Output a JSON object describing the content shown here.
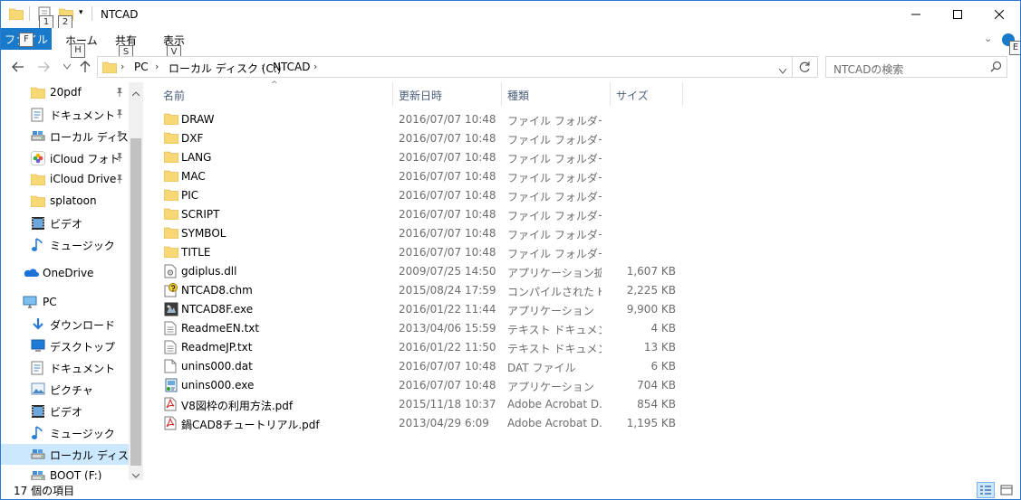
{
  "window": {
    "title": "NTCAD",
    "keytips": [
      "1",
      "2"
    ]
  },
  "ribbon": {
    "file_label": "ファイル",
    "file_keytip": "F",
    "tabs": [
      {
        "label": "ホーム",
        "keytip": "H"
      },
      {
        "label": "共有",
        "keytip": "S"
      },
      {
        "label": "表示",
        "keytip": "V"
      }
    ],
    "help_keytip": "E"
  },
  "address": {
    "crumbs": [
      "PC",
      "ローカル ディスク (C:)",
      "NTCAD"
    ]
  },
  "search": {
    "placeholder": "NTCADの検索"
  },
  "nav": {
    "items": [
      {
        "label": "20pdf",
        "icon": "folder-icon",
        "pinned": true
      },
      {
        "label": "ドキュメント",
        "icon": "documents-icon",
        "pinned": true
      },
      {
        "label": "ローカル ディスク",
        "icon": "drive-icon",
        "pinned": true
      },
      {
        "label": "iCloud フォト",
        "icon": "icloud-photos-icon",
        "pinned": true
      },
      {
        "label": "iCloud Drive",
        "icon": "icloud-drive-icon",
        "pinned": true
      },
      {
        "label": "splatoon",
        "icon": "folder-icon",
        "pinned": false
      },
      {
        "label": "ビデオ",
        "icon": "video-icon",
        "pinned": false
      },
      {
        "label": "ミュージック",
        "icon": "music-icon",
        "pinned": false
      },
      {
        "label": "OneDrive",
        "icon": "onedrive-icon",
        "pinned": false
      },
      {
        "label": "PC",
        "icon": "pc-icon",
        "pinned": false
      },
      {
        "label": "ダウンロード",
        "icon": "download-icon",
        "pinned": false
      },
      {
        "label": "デスクトップ",
        "icon": "desktop-icon",
        "pinned": false
      },
      {
        "label": "ドキュメント",
        "icon": "documents-icon",
        "pinned": false
      },
      {
        "label": "ピクチャ",
        "icon": "pictures-icon",
        "pinned": false
      },
      {
        "label": "ビデオ",
        "icon": "video-icon",
        "pinned": false
      },
      {
        "label": "ミュージック",
        "icon": "music-icon",
        "pinned": false
      },
      {
        "label": "ローカル ディスク (C",
        "icon": "drive-icon",
        "pinned": false,
        "selected": true
      },
      {
        "label": "BOOT (F:)",
        "icon": "drive-icon",
        "pinned": false
      }
    ]
  },
  "columns": {
    "name": "名前",
    "date": "更新日時",
    "type": "種類",
    "size": "サイズ"
  },
  "files": [
    {
      "name": "DRAW",
      "date": "2016/07/07 10:48",
      "type": "ファイル フォルダー",
      "size": "",
      "icon": "folder-icon"
    },
    {
      "name": "DXF",
      "date": "2016/07/07 10:48",
      "type": "ファイル フォルダー",
      "size": "",
      "icon": "folder-icon"
    },
    {
      "name": "LANG",
      "date": "2016/07/07 10:48",
      "type": "ファイル フォルダー",
      "size": "",
      "icon": "folder-icon"
    },
    {
      "name": "MAC",
      "date": "2016/07/07 10:48",
      "type": "ファイル フォルダー",
      "size": "",
      "icon": "folder-icon"
    },
    {
      "name": "PIC",
      "date": "2016/07/07 10:48",
      "type": "ファイル フォルダー",
      "size": "",
      "icon": "folder-icon"
    },
    {
      "name": "SCRIPT",
      "date": "2016/07/07 10:48",
      "type": "ファイル フォルダー",
      "size": "",
      "icon": "folder-icon"
    },
    {
      "name": "SYMBOL",
      "date": "2016/07/07 10:48",
      "type": "ファイル フォルダー",
      "size": "",
      "icon": "folder-icon"
    },
    {
      "name": "TITLE",
      "date": "2016/07/07 10:48",
      "type": "ファイル フォルダー",
      "size": "",
      "icon": "folder-icon"
    },
    {
      "name": "gdiplus.dll",
      "date": "2009/07/25 14:50",
      "type": "アプリケーション拡張",
      "size": "1,607 KB",
      "icon": "dll-icon"
    },
    {
      "name": "NTCAD8.chm",
      "date": "2015/08/24 17:59",
      "type": "コンパイルされた HT...",
      "size": "2,225 KB",
      "icon": "help-file-icon"
    },
    {
      "name": "NTCAD8F.exe",
      "date": "2016/01/22 11:44",
      "type": "アプリケーション",
      "size": "9,900 KB",
      "icon": "exe-icon"
    },
    {
      "name": "ReadmeEN.txt",
      "date": "2013/04/06 15:59",
      "type": "テキスト ドキュメント",
      "size": "4 KB",
      "icon": "text-file-icon"
    },
    {
      "name": "ReadmeJP.txt",
      "date": "2016/01/22 11:50",
      "type": "テキスト ドキュメント",
      "size": "13 KB",
      "icon": "text-file-icon"
    },
    {
      "name": "unins000.dat",
      "date": "2016/07/07 10:48",
      "type": "DAT ファイル",
      "size": "6 KB",
      "icon": "file-icon"
    },
    {
      "name": "unins000.exe",
      "date": "2016/07/07 10:48",
      "type": "アプリケーション",
      "size": "704 KB",
      "icon": "installer-icon"
    },
    {
      "name": "V8図枠の利用方法.pdf",
      "date": "2015/11/18 10:37",
      "type": "Adobe Acrobat D...",
      "size": "854 KB",
      "icon": "pdf-icon"
    },
    {
      "name": "鍋CAD8チュートリアル.pdf",
      "date": "2013/04/29 6:09",
      "type": "Adobe Acrobat D...",
      "size": "1,195 KB",
      "icon": "pdf-icon"
    }
  ],
  "status": {
    "count_text": "17 個の項目"
  },
  "colors": {
    "accent": "#1979ca",
    "selection": "#cce8ff",
    "folder": "#f8d775"
  }
}
